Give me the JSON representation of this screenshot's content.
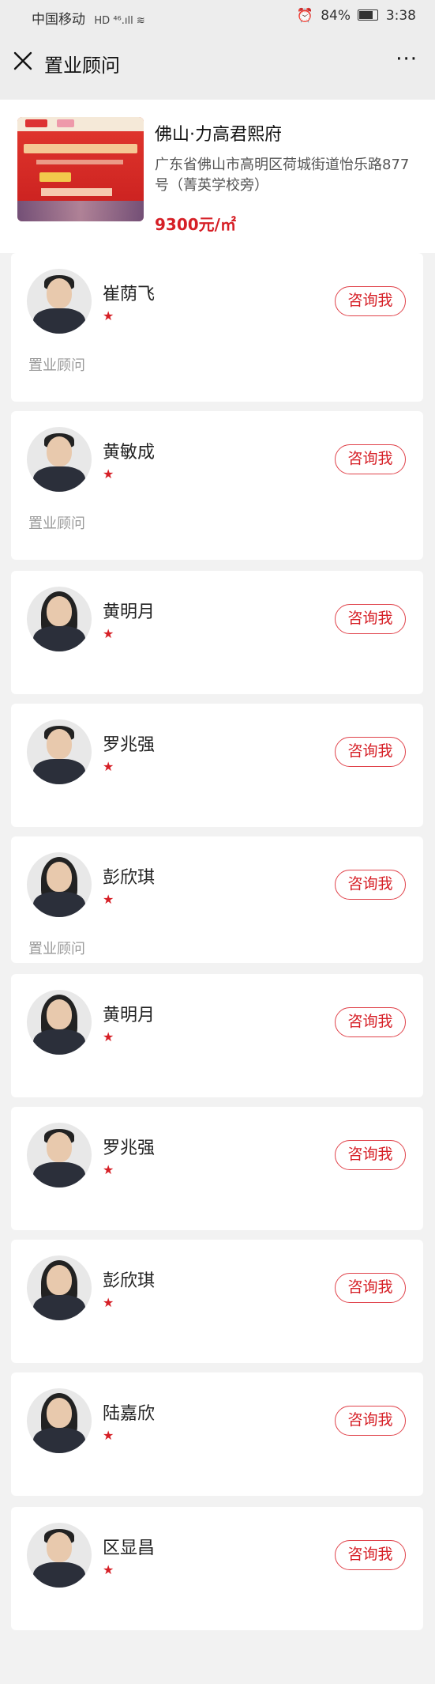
{
  "status_bar": {
    "carrier": "中国移动",
    "signal": "HD ⁴⁶.ıll ≋",
    "battery": "84%",
    "time": "3:38"
  },
  "nav": {
    "title": "置业顾问",
    "more": "···"
  },
  "project": {
    "name": "佛山·力高君熙府",
    "address": "广东省佛山市高明区荷城街道怡乐路877号（菁英学校旁）",
    "price": "9300元/㎡"
  },
  "consult_label": "咨询我",
  "role_label": "置业顾问",
  "advisors": [
    {
      "name": "崔荫飞",
      "gender": "male",
      "show_role": true
    },
    {
      "name": "黄敏成",
      "gender": "male",
      "show_role": true
    },
    {
      "name": "黄明月",
      "gender": "female",
      "show_role": false
    },
    {
      "name": "罗兆强",
      "gender": "male",
      "show_role": false
    },
    {
      "name": "彭欣琪",
      "gender": "female",
      "show_role": true
    },
    {
      "name": "黄明月",
      "gender": "female",
      "show_role": false
    },
    {
      "name": "罗兆强",
      "gender": "male",
      "show_role": false
    },
    {
      "name": "彭欣琪",
      "gender": "female",
      "show_role": false
    },
    {
      "name": "陆嘉欣",
      "gender": "female",
      "show_role": false
    },
    {
      "name": "区显昌",
      "gender": "male",
      "show_role": false
    }
  ],
  "colors": {
    "accent": "#d61f26",
    "background": "#f2f2f2",
    "nav_bg": "#ededed"
  }
}
